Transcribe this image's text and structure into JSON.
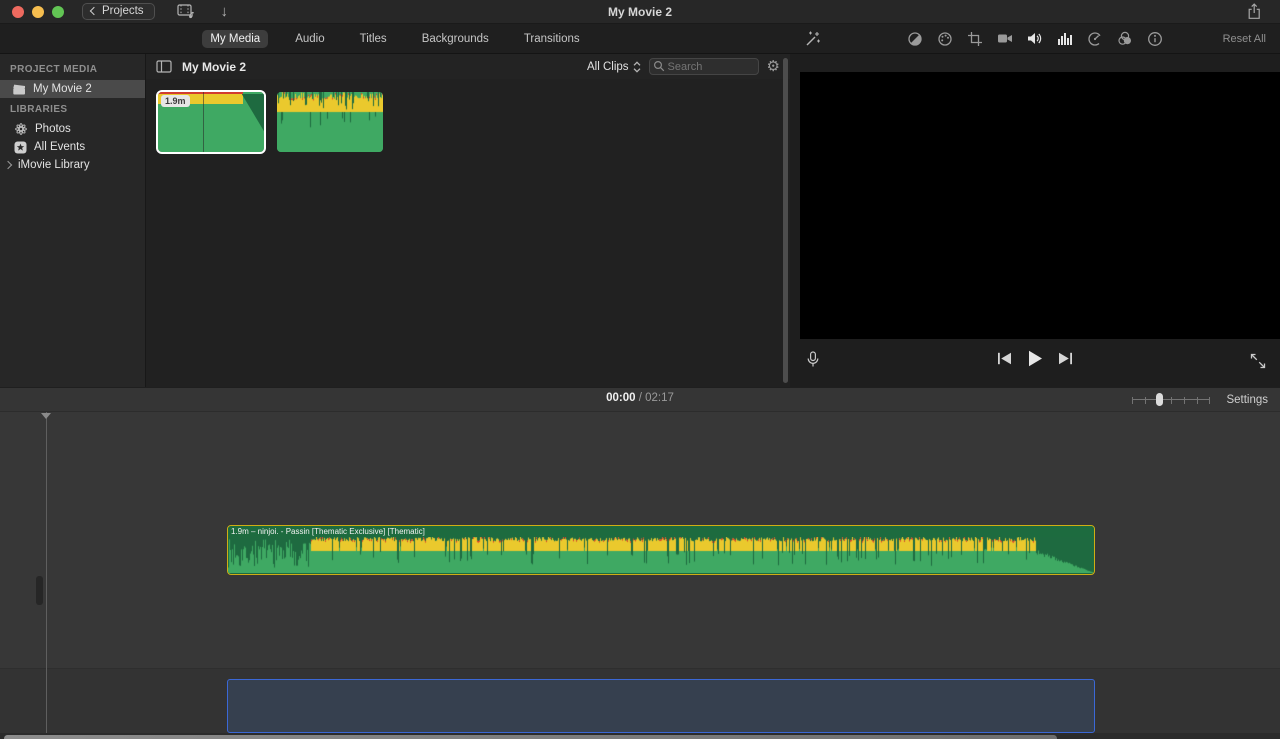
{
  "titlebar": {
    "back_label": "Projects",
    "title": "My Movie 2"
  },
  "tabs": {
    "items": [
      {
        "label": "My Media",
        "active": true
      },
      {
        "label": "Audio",
        "active": false
      },
      {
        "label": "Titles",
        "active": false
      },
      {
        "label": "Backgrounds",
        "active": false
      },
      {
        "label": "Transitions",
        "active": false
      }
    ]
  },
  "sidebar": {
    "project_media_header": "PROJECT MEDIA",
    "project_item_label": "My Movie 2",
    "libraries_header": "LIBRARIES",
    "photos_label": "Photos",
    "all_events_label": "All Events",
    "imovie_library_label": "iMovie Library"
  },
  "browser": {
    "title": "My Movie 2",
    "filter_label": "All Clips",
    "search_placeholder": "Search",
    "clip1_badge": "1.9m"
  },
  "viewer": {
    "reset_all_label": "Reset All"
  },
  "timeline_toolbar": {
    "current_time": "00:00",
    "time_separator": "/",
    "total_time": "02:17",
    "settings_label": "Settings"
  },
  "timeline": {
    "clip_label": "1.9m – ninjoi. - Passin [Thematic Exclusive] [Thematic]"
  },
  "icons": {
    "download_arrow": "↓",
    "gear": "⚙"
  },
  "colors": {
    "wave_light_green": "#3fa963",
    "wave_dark_green": "#1e6a40",
    "wave_yellow": "#eac92d",
    "wave_red": "#df3a2c",
    "clip_selection_yellow": "#cfae14",
    "thumb_selection_white": "#ffffff",
    "track_placeholder_fill": "#36404f",
    "track_placeholder_border": "#3b68d6"
  }
}
